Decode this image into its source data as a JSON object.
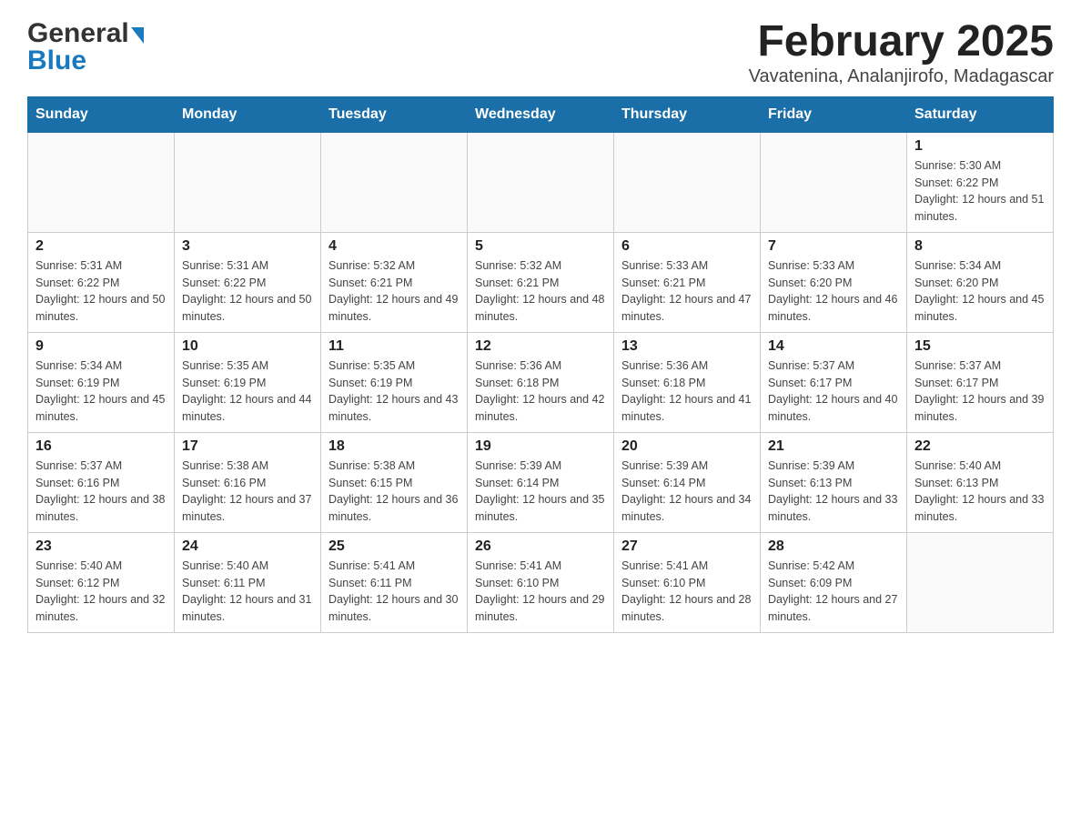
{
  "logo": {
    "general": "General",
    "blue": "Blue",
    "arrow": "▶"
  },
  "title": "February 2025",
  "subtitle": "Vavatenina, Analanjirofo, Madagascar",
  "days_of_week": [
    "Sunday",
    "Monday",
    "Tuesday",
    "Wednesday",
    "Thursday",
    "Friday",
    "Saturday"
  ],
  "weeks": [
    [
      {
        "day": "",
        "info": ""
      },
      {
        "day": "",
        "info": ""
      },
      {
        "day": "",
        "info": ""
      },
      {
        "day": "",
        "info": ""
      },
      {
        "day": "",
        "info": ""
      },
      {
        "day": "",
        "info": ""
      },
      {
        "day": "1",
        "info": "Sunrise: 5:30 AM\nSunset: 6:22 PM\nDaylight: 12 hours and 51 minutes."
      }
    ],
    [
      {
        "day": "2",
        "info": "Sunrise: 5:31 AM\nSunset: 6:22 PM\nDaylight: 12 hours and 50 minutes."
      },
      {
        "day": "3",
        "info": "Sunrise: 5:31 AM\nSunset: 6:22 PM\nDaylight: 12 hours and 50 minutes."
      },
      {
        "day": "4",
        "info": "Sunrise: 5:32 AM\nSunset: 6:21 PM\nDaylight: 12 hours and 49 minutes."
      },
      {
        "day": "5",
        "info": "Sunrise: 5:32 AM\nSunset: 6:21 PM\nDaylight: 12 hours and 48 minutes."
      },
      {
        "day": "6",
        "info": "Sunrise: 5:33 AM\nSunset: 6:21 PM\nDaylight: 12 hours and 47 minutes."
      },
      {
        "day": "7",
        "info": "Sunrise: 5:33 AM\nSunset: 6:20 PM\nDaylight: 12 hours and 46 minutes."
      },
      {
        "day": "8",
        "info": "Sunrise: 5:34 AM\nSunset: 6:20 PM\nDaylight: 12 hours and 45 minutes."
      }
    ],
    [
      {
        "day": "9",
        "info": "Sunrise: 5:34 AM\nSunset: 6:19 PM\nDaylight: 12 hours and 45 minutes."
      },
      {
        "day": "10",
        "info": "Sunrise: 5:35 AM\nSunset: 6:19 PM\nDaylight: 12 hours and 44 minutes."
      },
      {
        "day": "11",
        "info": "Sunrise: 5:35 AM\nSunset: 6:19 PM\nDaylight: 12 hours and 43 minutes."
      },
      {
        "day": "12",
        "info": "Sunrise: 5:36 AM\nSunset: 6:18 PM\nDaylight: 12 hours and 42 minutes."
      },
      {
        "day": "13",
        "info": "Sunrise: 5:36 AM\nSunset: 6:18 PM\nDaylight: 12 hours and 41 minutes."
      },
      {
        "day": "14",
        "info": "Sunrise: 5:37 AM\nSunset: 6:17 PM\nDaylight: 12 hours and 40 minutes."
      },
      {
        "day": "15",
        "info": "Sunrise: 5:37 AM\nSunset: 6:17 PM\nDaylight: 12 hours and 39 minutes."
      }
    ],
    [
      {
        "day": "16",
        "info": "Sunrise: 5:37 AM\nSunset: 6:16 PM\nDaylight: 12 hours and 38 minutes."
      },
      {
        "day": "17",
        "info": "Sunrise: 5:38 AM\nSunset: 6:16 PM\nDaylight: 12 hours and 37 minutes."
      },
      {
        "day": "18",
        "info": "Sunrise: 5:38 AM\nSunset: 6:15 PM\nDaylight: 12 hours and 36 minutes."
      },
      {
        "day": "19",
        "info": "Sunrise: 5:39 AM\nSunset: 6:14 PM\nDaylight: 12 hours and 35 minutes."
      },
      {
        "day": "20",
        "info": "Sunrise: 5:39 AM\nSunset: 6:14 PM\nDaylight: 12 hours and 34 minutes."
      },
      {
        "day": "21",
        "info": "Sunrise: 5:39 AM\nSunset: 6:13 PM\nDaylight: 12 hours and 33 minutes."
      },
      {
        "day": "22",
        "info": "Sunrise: 5:40 AM\nSunset: 6:13 PM\nDaylight: 12 hours and 33 minutes."
      }
    ],
    [
      {
        "day": "23",
        "info": "Sunrise: 5:40 AM\nSunset: 6:12 PM\nDaylight: 12 hours and 32 minutes."
      },
      {
        "day": "24",
        "info": "Sunrise: 5:40 AM\nSunset: 6:11 PM\nDaylight: 12 hours and 31 minutes."
      },
      {
        "day": "25",
        "info": "Sunrise: 5:41 AM\nSunset: 6:11 PM\nDaylight: 12 hours and 30 minutes."
      },
      {
        "day": "26",
        "info": "Sunrise: 5:41 AM\nSunset: 6:10 PM\nDaylight: 12 hours and 29 minutes."
      },
      {
        "day": "27",
        "info": "Sunrise: 5:41 AM\nSunset: 6:10 PM\nDaylight: 12 hours and 28 minutes."
      },
      {
        "day": "28",
        "info": "Sunrise: 5:42 AM\nSunset: 6:09 PM\nDaylight: 12 hours and 27 minutes."
      },
      {
        "day": "",
        "info": ""
      }
    ]
  ]
}
